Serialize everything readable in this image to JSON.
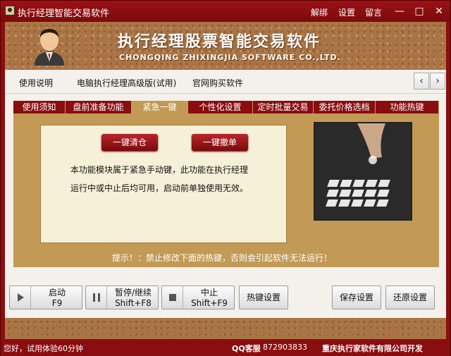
{
  "window": {
    "title": "执行经理智能交易软件",
    "links": [
      "解绑",
      "设置",
      "留言"
    ]
  },
  "banner": {
    "title": "执行经理股票智能交易软件",
    "subtitle": "CHONGQING ZHIXINGJIA SOFTWARE CO.,LTD."
  },
  "menu": {
    "items": [
      "使用说明",
      "电脑执行经理高级版(试用)",
      "官网购买软件"
    ]
  },
  "tabs": [
    "使用须知",
    "盘前准备功能",
    "紧急一键",
    "个性化设置",
    "定时批量交易",
    "委托价格选档",
    "功能热键"
  ],
  "panel": {
    "clear_button": "一键清仓",
    "cancel_button": "一键撤单",
    "desc_line1": "本功能模块属于紧急手动键，此功能在执行经理",
    "desc_line2": "运行中或中止后均可用，启动前单独使用无效。",
    "hint": "提示！：禁止修改下面的热键，否则会引起软件无法运行！"
  },
  "controls": {
    "start_label": "启动",
    "start_key": "F9",
    "pause_label": "暂停/继续",
    "pause_key": "Shift+F8",
    "stop_label": "中止",
    "stop_key": "Shift+F9",
    "hotkey_label": "热键设置",
    "save_label": "保存设置",
    "restore_label": "还原设置"
  },
  "status": {
    "trial": "您好，试用体验60分钟",
    "qq_label": "QQ客服",
    "qq_number": "872903833",
    "company": "重庆执行家软件有限公司开发"
  }
}
